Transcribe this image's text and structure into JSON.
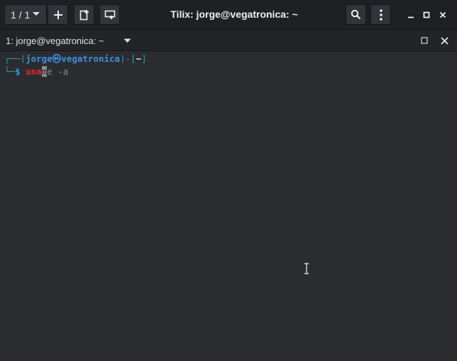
{
  "headerbar": {
    "session_label": "1 / 1",
    "title": "Tilix: jorge@vegatronica: ~"
  },
  "terminal_tab": {
    "title": "1: jorge@vegatronica: ~"
  },
  "prompt": {
    "open": "┌──(",
    "user": "jorge",
    "at": "㉿",
    "host": "vegatronica",
    "mid": ")-[",
    "dir": "~",
    "close": "]",
    "corner": "└─",
    "dollar": "$",
    "cmd_pre": "una",
    "cmd_cursor": "m",
    "cmd_post": "e -a"
  },
  "icons": [
    "chevron-down-icon",
    "plus-icon",
    "split-vertical-icon",
    "split-horizontal-icon",
    "search-icon",
    "kebab-menu-icon",
    "minimize-icon",
    "maximize-icon",
    "close-icon",
    "text-cursor-icon"
  ],
  "colors": {
    "background": "#2b2c30",
    "headerbar": "#1f2023",
    "prompt_cyan": "#2e9fa8",
    "prompt_blue": "#3d8fe5",
    "command_red": "#e0282c"
  }
}
